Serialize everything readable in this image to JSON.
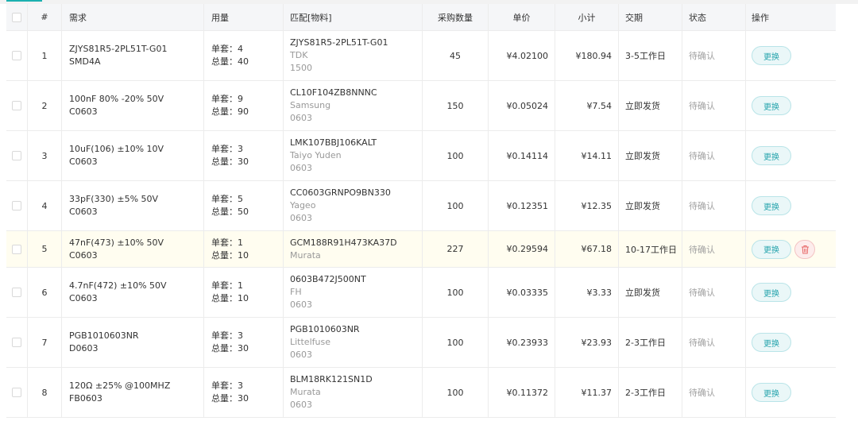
{
  "columns": {
    "num": "#",
    "requirement": "需求",
    "usage": "用量",
    "match": "匹配[物料]",
    "purchase_qty": "采购数量",
    "unit_price": "单价",
    "subtotal": "小计",
    "lead_time": "交期",
    "status": "状态",
    "actions": "操作"
  },
  "labels": {
    "per_set": "单套：",
    "total": "总量："
  },
  "replace_label": "更换",
  "colors": {
    "accent": "#1bb0b0",
    "button_text": "#26a4ad",
    "delete": "#e86a6a",
    "highlight_row": "#fffdf0"
  },
  "rows": [
    {
      "num": "1",
      "req_1": "ZJYS81R5-2PL51T-G01",
      "req_2": "SMD4A",
      "per_set": "4",
      "total": "40",
      "part": "ZJYS81R5-2PL51T-G01",
      "maker": "TDK",
      "pkg": "1500",
      "qty": "45",
      "price": "¥4.02100",
      "subtotal": "¥180.94",
      "lead": "3-5工作日",
      "status": "待确认"
    },
    {
      "num": "2",
      "req_1": "100nF 80% -20% 50V",
      "req_2": "C0603",
      "per_set": "9",
      "total": "90",
      "part": "CL10F104ZB8NNNC",
      "maker": "Samsung",
      "pkg": "0603",
      "qty": "150",
      "price": "¥0.05024",
      "subtotal": "¥7.54",
      "lead": "立即发货",
      "status": "待确认"
    },
    {
      "num": "3",
      "req_1": "10uF(106) ±10% 10V",
      "req_2": "C0603",
      "per_set": "3",
      "total": "30",
      "part": "LMK107BBJ106KALT",
      "maker": "Taiyo Yuden",
      "pkg": "0603",
      "qty": "100",
      "price": "¥0.14114",
      "subtotal": "¥14.11",
      "lead": "立即发货",
      "status": "待确认"
    },
    {
      "num": "4",
      "req_1": "33pF(330) ±5% 50V",
      "req_2": "C0603",
      "per_set": "5",
      "total": "50",
      "part": "CC0603GRNPO9BN330",
      "maker": "Yageo",
      "pkg": "0603",
      "qty": "100",
      "price": "¥0.12351",
      "subtotal": "¥12.35",
      "lead": "立即发货",
      "status": "待确认"
    },
    {
      "num": "5",
      "req_1": "47nF(473) ±10% 50V",
      "req_2": "C0603",
      "per_set": "1",
      "total": "10",
      "part": "GCM188R91H473KA37D",
      "maker": "Murata",
      "pkg": "",
      "qty": "227",
      "price": "¥0.29594",
      "subtotal": "¥67.18",
      "lead": "10-17工作日",
      "status": "待确认"
    },
    {
      "num": "6",
      "req_1": "4.7nF(472) ±10% 50V",
      "req_2": "C0603",
      "per_set": "1",
      "total": "10",
      "part": "0603B472J500NT",
      "maker": "FH",
      "pkg": "0603",
      "qty": "100",
      "price": "¥0.03335",
      "subtotal": "¥3.33",
      "lead": "立即发货",
      "status": "待确认"
    },
    {
      "num": "7",
      "req_1": "PGB1010603NR",
      "req_2": "D0603",
      "per_set": "3",
      "total": "30",
      "part": "PGB1010603NR",
      "maker": "Littelfuse",
      "pkg": "0603",
      "qty": "100",
      "price": "¥0.23933",
      "subtotal": "¥23.93",
      "lead": "2-3工作日",
      "status": "待确认"
    },
    {
      "num": "8",
      "req_1": "120Ω ±25% @100MHZ",
      "req_2": "FB0603",
      "per_set": "3",
      "total": "30",
      "part": "BLM18RK121SN1D",
      "maker": "Murata",
      "pkg": "0603",
      "qty": "100",
      "price": "¥0.11372",
      "subtotal": "¥11.37",
      "lead": "2-3工作日",
      "status": "待确认"
    }
  ]
}
